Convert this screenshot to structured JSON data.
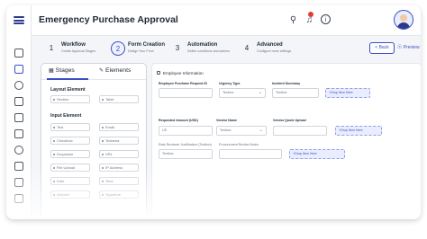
{
  "header": {
    "title": "Emergency Purchase Approval",
    "notification_count": "1"
  },
  "colors": {
    "accent": "#3b4fc4",
    "badge": "#e53935",
    "drop_zone": "#e9edff"
  },
  "stepper": {
    "steps": [
      {
        "num": "1",
        "title": "Workflow",
        "desc": "Create Approval Stages"
      },
      {
        "num": "2",
        "title": "Form Creation",
        "desc": "Design Your Form"
      },
      {
        "num": "3",
        "title": "Automation",
        "desc": "Define conditions and actions"
      },
      {
        "num": "4",
        "title": "Advanced",
        "desc": "Configure more settings"
      }
    ],
    "back_label": "< Back",
    "preview_label": "Preview"
  },
  "panel": {
    "tab_stages": "Stages",
    "tab_elements": "Elements",
    "layout_heading": "Layout Element",
    "layout_items": [
      "Section",
      "Table"
    ],
    "input_heading": "Input Element",
    "input_items": [
      "Text",
      "Email",
      "Checkbox",
      "Textarea",
      "Dropdown",
      "URL",
      "File Upload",
      "IP Address",
      "Date",
      "Time",
      "Number",
      "Signature"
    ]
  },
  "form": {
    "section_title": "Employee Information",
    "fields": {
      "request_id": {
        "label": "Employee Purchase Request ID",
        "value": ""
      },
      "urgency": {
        "label": "Urgency Type",
        "value": "Textbox"
      },
      "incident_summary": {
        "label": "Incident Summary",
        "value": "Textbox"
      },
      "drop1": "+Drop Item Here",
      "amount": {
        "label": "Requested Amount (USD)",
        "value": "US"
      },
      "vendor_name": {
        "label": "Vendor Name",
        "value": "Textbox"
      },
      "vendor_quote": {
        "label": "Vendor Quote Upload",
        "value": ""
      },
      "drop2": "+Drop Item Here",
      "justification": {
        "label": "Rate Reviewer Justification (Textbox)",
        "value": "Textbox"
      },
      "reviewer_notes": {
        "label": "Procurement Review Notes",
        "value": ""
      },
      "drop3": "+Drop Item Here"
    }
  }
}
